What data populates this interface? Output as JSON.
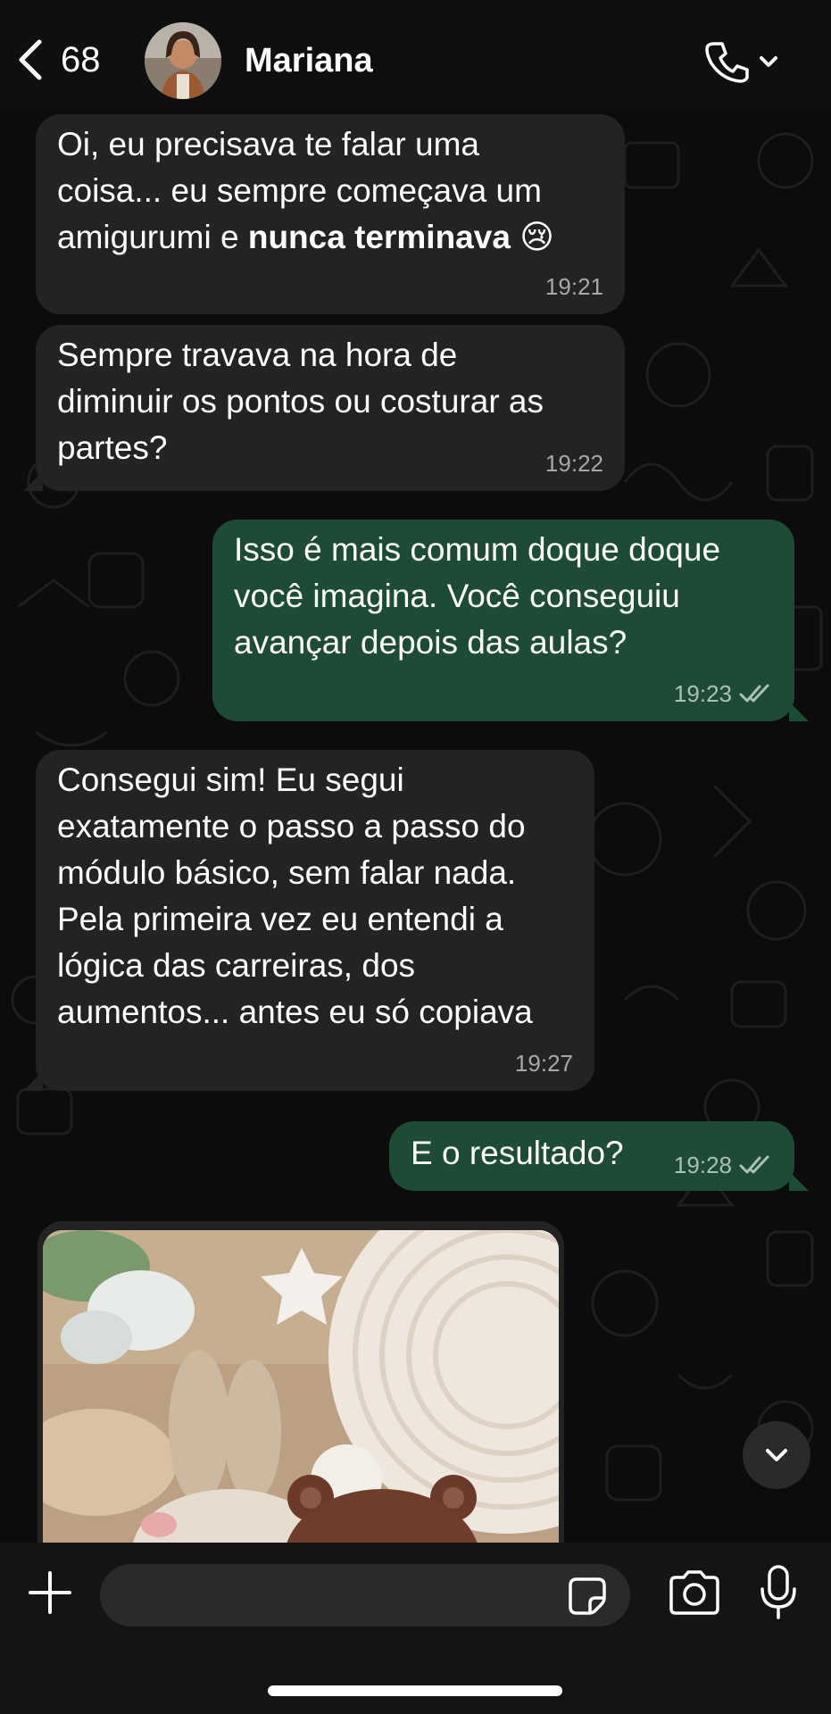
{
  "header": {
    "back_count": "68",
    "contact_name": "Mariana",
    "icons": {
      "back": "chevron-left-icon",
      "call": "phone-icon",
      "call_menu": "chevron-down-icon"
    }
  },
  "messages": [
    {
      "direction": "incoming",
      "time": "19:21"
    },
    {
      "direction": "incoming",
      "text": "Sempre travava na hora de\ndiminuir os pontos ou costurar as\npartes?",
      "time": "19:22"
    },
    {
      "direction": "outgoing",
      "text": "Isso é mais comum doque doque\nvocê imagina. Você conseguiu\navançar depois das aulas?",
      "time": "19:23",
      "status": "read"
    },
    {
      "direction": "incoming",
      "text": "Consegui sim! Eu segui\nexatamente o passo a passo do\nmódulo básico, sem falar nada.\nPela primeira vez eu entendi a\nlógica das carreiras, dos\naumentos... antes eu só copiava",
      "time": "19:27"
    },
    {
      "direction": "outgoing",
      "text": "E o resultado?",
      "time": "19:28",
      "status": "read"
    }
  ],
  "first_message": {
    "line1": "Oi, eu precisava te falar uma",
    "line2": "coisa... eu sempre começava um",
    "line3_prefix": "amigurumi e ",
    "line3_bold": "nunca terminava",
    "emoji": "😢"
  },
  "image_message": {
    "kind": "photo",
    "subject": "crochet amigurumi"
  },
  "composer": {
    "placeholder": "",
    "icons": {
      "attach": "plus-icon",
      "sticker": "sticker-icon",
      "camera": "camera-icon",
      "voice": "microphone-icon"
    }
  },
  "scroll_button": {
    "icon": "chevron-down-icon"
  },
  "colors": {
    "incoming_bubble": "#232323",
    "outgoing_bubble": "#1d4b35",
    "background": "#0c0c0c"
  }
}
